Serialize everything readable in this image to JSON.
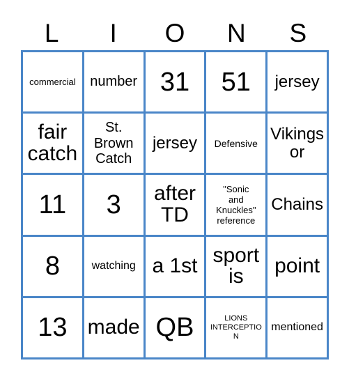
{
  "card": {
    "title_letters": [
      "L",
      "I",
      "O",
      "N",
      "S"
    ],
    "border_color": "#4a86c8",
    "text_color": "#000000",
    "background_color": "#ffffff",
    "rows": 5,
    "columns": 5,
    "cells": [
      [
        {
          "text": "commercial",
          "size": "xs"
        },
        {
          "text": "number",
          "size": "ml"
        },
        {
          "text": "31",
          "size": "xxl"
        },
        {
          "text": "51",
          "size": "xxl"
        },
        {
          "text": "jersey",
          "size": "l"
        }
      ],
      [
        {
          "text": "fair\ncatch",
          "size": "xl"
        },
        {
          "text": "St.\nBrown\nCatch",
          "size": "ml"
        },
        {
          "text": "jersey",
          "size": "l"
        },
        {
          "text": "Defensive",
          "size": "s"
        },
        {
          "text": "Vikings\nor",
          "size": "l"
        }
      ],
      [
        {
          "text": "11",
          "size": "xxl"
        },
        {
          "text": "3",
          "size": "xxl"
        },
        {
          "text": "after\nTD",
          "size": "xl"
        },
        {
          "text": "\"Sonic\nand\nKnuckles\"\nreference",
          "size": "xs"
        },
        {
          "text": "Chains",
          "size": "l"
        }
      ],
      [
        {
          "text": "8",
          "size": "xxl"
        },
        {
          "text": "watching",
          "size": "m"
        },
        {
          "text": "a 1st",
          "size": "xl"
        },
        {
          "text": "sport\nis",
          "size": "xl"
        },
        {
          "text": "point",
          "size": "xl"
        }
      ],
      [
        {
          "text": "13",
          "size": "xxl"
        },
        {
          "text": "made",
          "size": "xl"
        },
        {
          "text": "QB",
          "size": "xxl"
        },
        {
          "text": "LIONS\nINTERCEPTION",
          "size": "xxs"
        },
        {
          "text": "mentioned",
          "size": "m"
        }
      ]
    ]
  }
}
